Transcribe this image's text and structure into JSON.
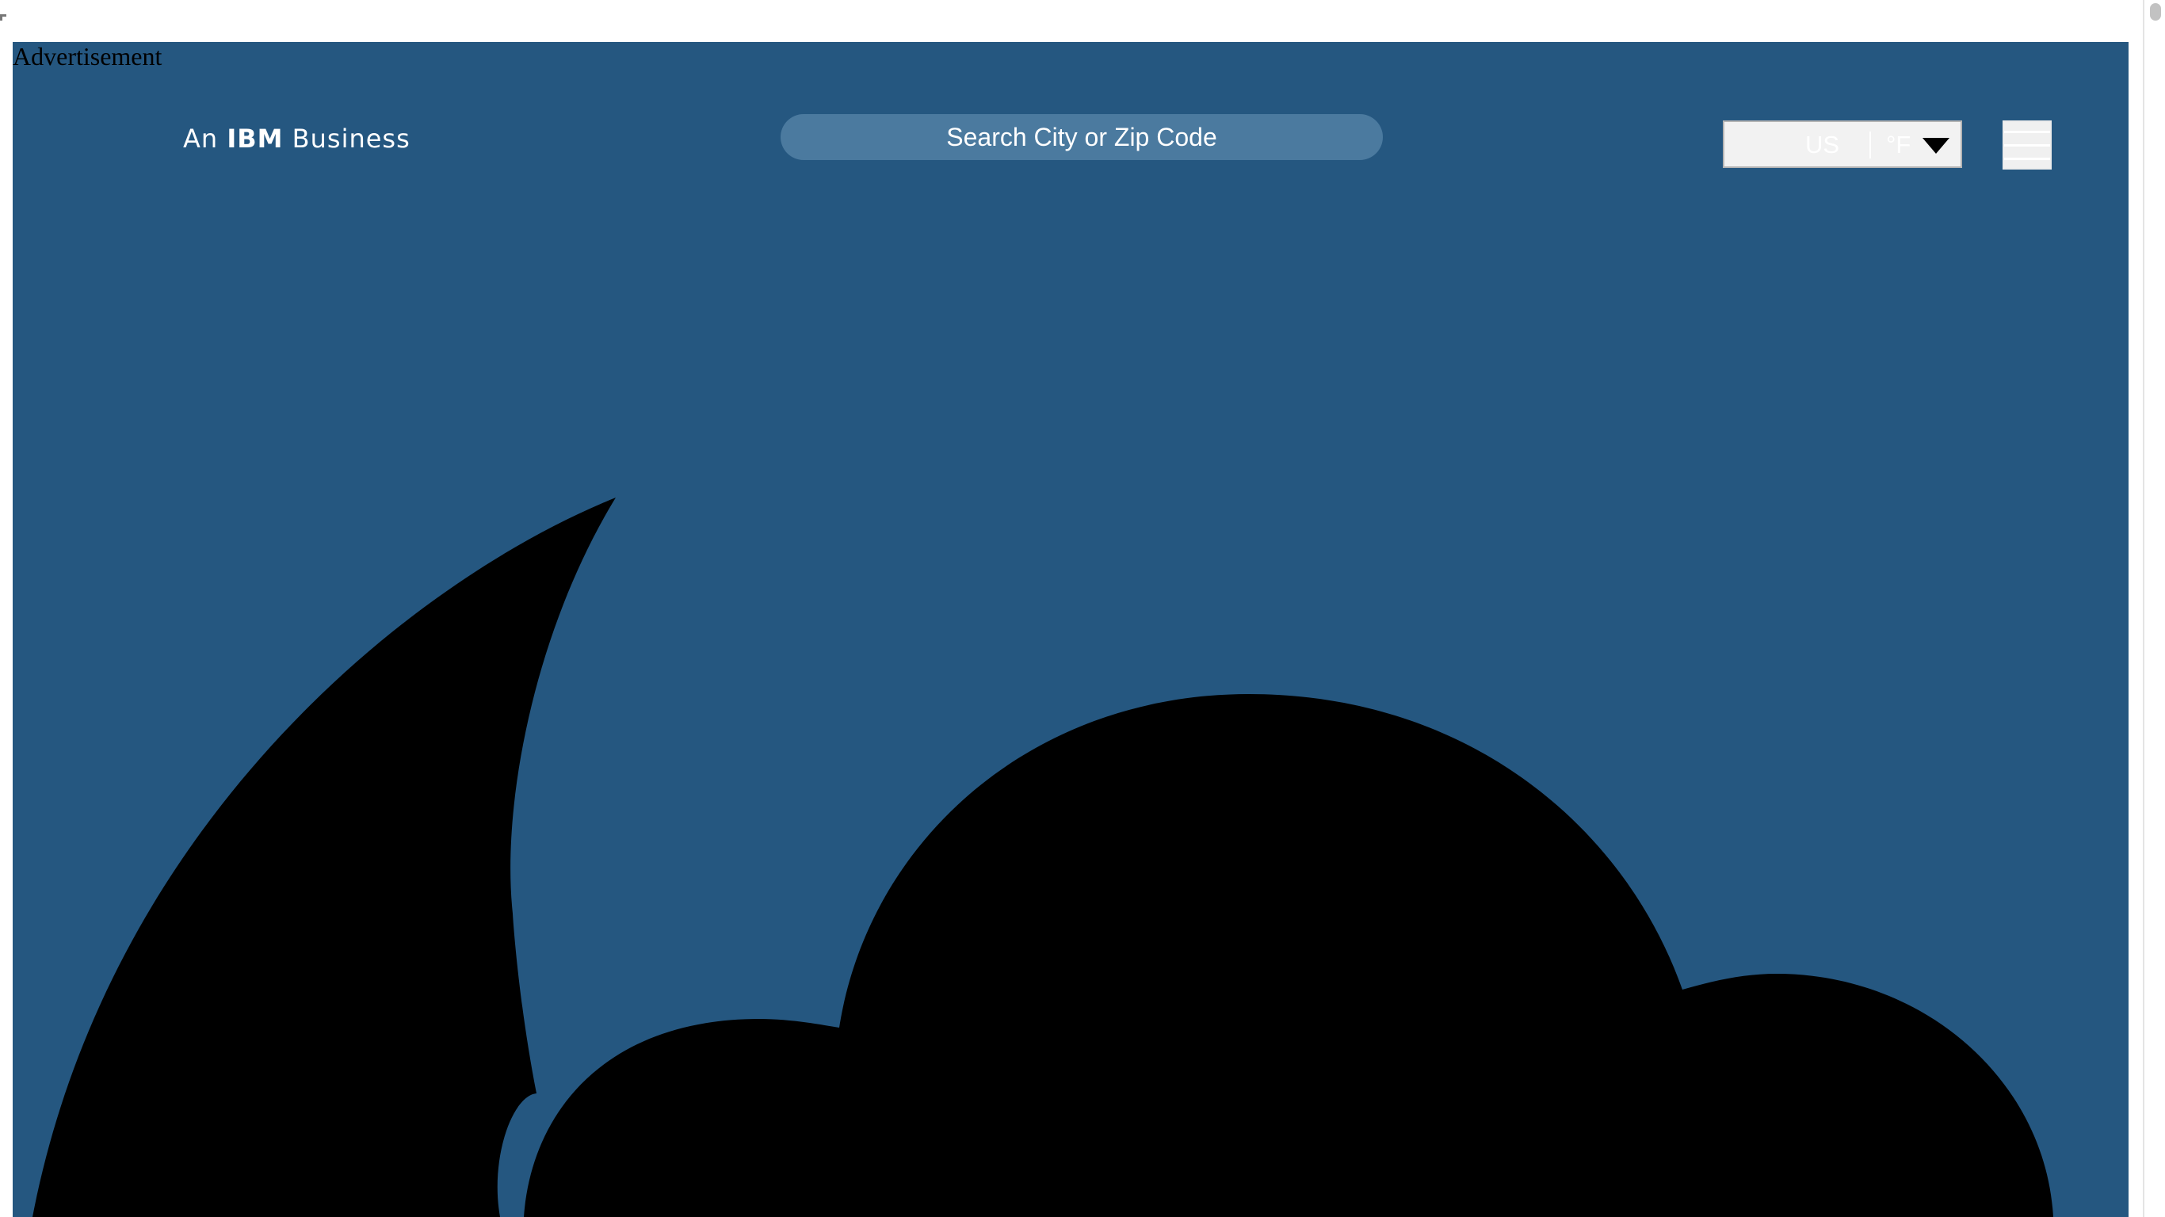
{
  "advertisement": {
    "label": "Advertisement"
  },
  "header": {
    "tagline_prefix": "An",
    "tagline_brand": "IBM",
    "tagline_suffix": "Business",
    "search_label": "Search City or Zip Code",
    "unit_region": "US",
    "unit_temperature": "°F",
    "menu_icon": "hamburger-menu-icon"
  },
  "colors": {
    "header_background": "#255780",
    "search_background": "#4b7a9f",
    "weather_icon_fill": "#000000"
  },
  "weather_icon": {
    "name": "partly-cloudy-night-icon"
  }
}
